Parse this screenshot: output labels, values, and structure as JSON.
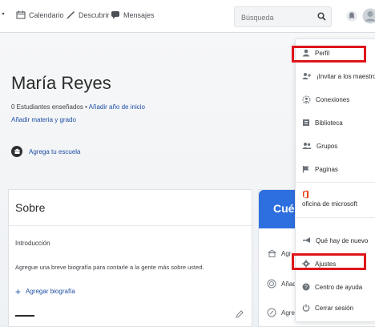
{
  "nav": {
    "calendar": "Calendario",
    "discover": "Descubrir",
    "messages": "Mensajes"
  },
  "search": {
    "placeholder": "Búsqueda"
  },
  "profile": {
    "name": "María Reyes",
    "students": "0 Estudiantes enseñados",
    "separator": "•",
    "add_start_year": "Añadir año de inicio",
    "add_subject_grade": "Añadir materia y grado",
    "add_school": "Agrega tu escuela"
  },
  "about": {
    "title": "Sobre",
    "intro_label": "Introducción",
    "intro_text": "Agregue una breve biografía para contarle a la gente más sobre usted.",
    "add_bio": "Agregar biografía"
  },
  "side_card": {
    "header": "Cuén",
    "row1": "Agr",
    "row2": "Añadi",
    "row3": "Agreg"
  },
  "menu": {
    "items": [
      {
        "label": "Perfil",
        "icon": "user-icon"
      },
      {
        "label": "¡Invitar a los maestros!",
        "icon": "invite-users-icon"
      },
      {
        "label": "Conexiones",
        "icon": "connections-icon"
      },
      {
        "label": "Biblioteca",
        "icon": "library-icon"
      },
      {
        "label": "Grupos",
        "icon": "groups-icon"
      },
      {
        "label": "Paginas",
        "icon": "pages-icon"
      },
      {
        "label": "oficina de microsoft",
        "icon": "office-icon"
      },
      {
        "label": "Qué hay de nuevo",
        "icon": "megaphone-icon"
      },
      {
        "label": "Ajustes",
        "icon": "gear-icon"
      },
      {
        "label": "Centro de ayuda",
        "icon": "help-icon"
      },
      {
        "label": "Cerrar sesión",
        "icon": "power-icon"
      }
    ]
  },
  "colors": {
    "highlight": "#e0151c",
    "link": "#1f4fa5",
    "accent": "#2e6fe0",
    "office": "#e8401c"
  }
}
